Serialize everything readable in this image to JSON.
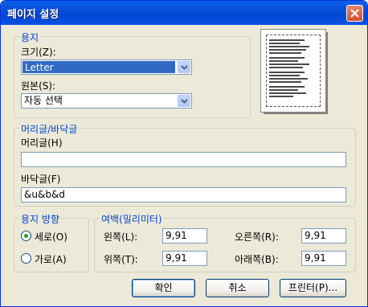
{
  "window": {
    "title": "페이지 설정"
  },
  "paper": {
    "legend": "용지",
    "size_label": "크기(Z):",
    "size_value": "Letter",
    "source_label": "원본(S):",
    "source_value": "자동 선택"
  },
  "headers_footers": {
    "legend": "머리글/바닥글",
    "header_label": "머리글(H)",
    "header_value": "",
    "footer_label": "바닥글(F)",
    "footer_value": "&u&b&d"
  },
  "orientation": {
    "legend": "용지 방향",
    "portrait_label": "세로(O)",
    "landscape_label": "가로(A)",
    "selected": "portrait"
  },
  "margins": {
    "legend": "여백(밀리미터)",
    "left_label": "왼쪽(L):",
    "left_value": "9,91",
    "right_label": "오른쪽(R):",
    "right_value": "9,91",
    "top_label": "위쪽(T):",
    "top_value": "9,91",
    "bottom_label": "아래쪽(B):",
    "bottom_value": "9,91"
  },
  "buttons": {
    "ok": "확인",
    "cancel": "취소",
    "printer": "프린터(P)..."
  },
  "colors": {
    "titlebar": "#0a5fe8",
    "accent": "#316ac5",
    "legend": "#0046d5",
    "face": "#ece9d8"
  }
}
